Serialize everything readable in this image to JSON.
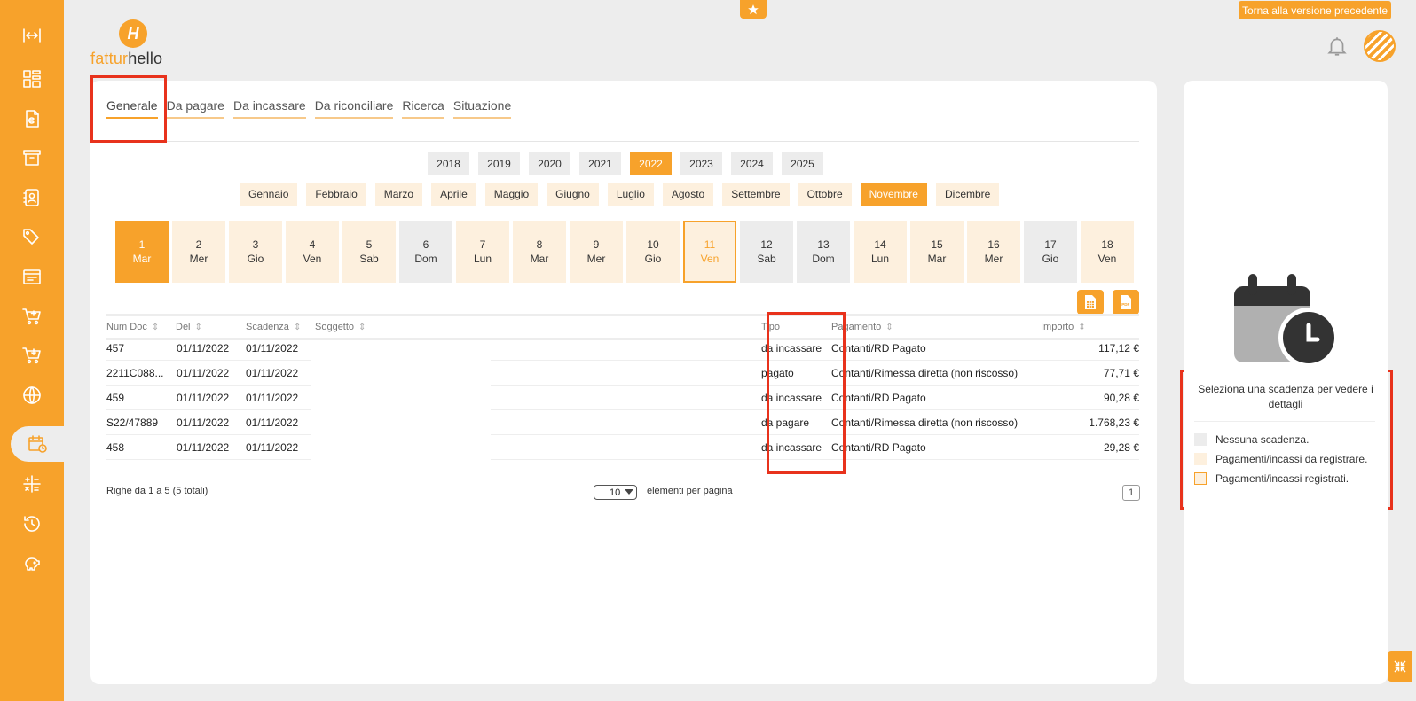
{
  "top": {
    "prev_version": "Torna alla versione precedente"
  },
  "logo": {
    "part1": "fattur",
    "part2": "hello"
  },
  "sidebar_icons": [
    "expand-icon",
    "dashboard-icon",
    "invoice-icon",
    "archive-icon",
    "contacts-icon",
    "tags-icon",
    "documents-icon",
    "cart-icon",
    "cart-download-icon",
    "globe-icon",
    "calendar-clock-icon",
    "calculator-icon",
    "history-icon",
    "piggy-bank-icon"
  ],
  "tabs": [
    "Generale",
    "Da pagare",
    "Da incassare",
    "Da riconciliare",
    "Ricerca",
    "Situazione"
  ],
  "years": [
    "2018",
    "2019",
    "2020",
    "2021",
    "2022",
    "2023",
    "2024",
    "2025"
  ],
  "selected_year": "2022",
  "months": [
    "Gennaio",
    "Febbraio",
    "Marzo",
    "Aprile",
    "Maggio",
    "Giugno",
    "Luglio",
    "Agosto",
    "Settembre",
    "Ottobre",
    "Novembre",
    "Dicembre"
  ],
  "selected_month": "Novembre",
  "days": [
    {
      "n": "1",
      "d": "Mar",
      "state": "sel"
    },
    {
      "n": "2",
      "d": "Mer",
      "state": "pend"
    },
    {
      "n": "3",
      "d": "Gio",
      "state": "pend"
    },
    {
      "n": "4",
      "d": "Ven",
      "state": "pend"
    },
    {
      "n": "5",
      "d": "Sab",
      "state": "pend"
    },
    {
      "n": "6",
      "d": "Dom",
      "state": "none"
    },
    {
      "n": "7",
      "d": "Lun",
      "state": "pend"
    },
    {
      "n": "8",
      "d": "Mar",
      "state": "pend"
    },
    {
      "n": "9",
      "d": "Mer",
      "state": "pend"
    },
    {
      "n": "10",
      "d": "Gio",
      "state": "pend"
    },
    {
      "n": "11",
      "d": "Ven",
      "state": "today"
    },
    {
      "n": "12",
      "d": "Sab",
      "state": "none"
    },
    {
      "n": "13",
      "d": "Dom",
      "state": "none"
    },
    {
      "n": "14",
      "d": "Lun",
      "state": "pend"
    },
    {
      "n": "15",
      "d": "Mar",
      "state": "pend"
    },
    {
      "n": "16",
      "d": "Mer",
      "state": "pend"
    },
    {
      "n": "17",
      "d": "Gio",
      "state": "none"
    },
    {
      "n": "18",
      "d": "Ven",
      "state": "pend"
    }
  ],
  "table": {
    "headers": {
      "num_doc": "Num Doc",
      "del": "Del",
      "scadenza": "Scadenza",
      "soggetto": "Soggetto",
      "tipo": "Tipo",
      "pagamento": "Pagamento",
      "importo": "Importo"
    },
    "rows": [
      {
        "num": "457",
        "del": "01/11/2022",
        "scad": "01/11/2022",
        "tipo": "da incassare",
        "pag": "Contanti/RD Pagato",
        "imp": "117,12 €"
      },
      {
        "num": "2211C088...",
        "del": "01/11/2022",
        "scad": "01/11/2022",
        "tipo": "pagato",
        "pag": "Contanti/Rimessa diretta (non riscosso)",
        "imp": "77,71 €"
      },
      {
        "num": "459",
        "del": "01/11/2022",
        "scad": "01/11/2022",
        "tipo": "da incassare",
        "pag": "Contanti/RD Pagato",
        "imp": "90,28 €"
      },
      {
        "num": "S22/47889",
        "del": "01/11/2022",
        "scad": "01/11/2022",
        "tipo": "da pagare",
        "pag": "Contanti/Rimessa diretta (non riscosso)",
        "imp": "1.768,23 €"
      },
      {
        "num": "458",
        "del": "01/11/2022",
        "scad": "01/11/2022",
        "tipo": "da incassare",
        "pag": "Contanti/RD Pagato",
        "imp": "29,28 €"
      }
    ]
  },
  "footer": {
    "rows_info": "Righe da 1 a 5 (5 totali)",
    "page_size": "10",
    "per_page": "elementi per pagina",
    "page": "1"
  },
  "right_panel": {
    "hint": "Seleziona una scadenza per vedere i dettagli",
    "legend": [
      {
        "label": "Nessuna scadenza.",
        "color": "#ececec"
      },
      {
        "label": "Pagamenti/incassi da registrare.",
        "color": "#fdf0de"
      },
      {
        "label": "Pagamenti/incassi registrati.",
        "color": "#fdf0de"
      }
    ]
  },
  "colors": {
    "accent": "#f7a22b",
    "highlight": "#e8321c"
  }
}
